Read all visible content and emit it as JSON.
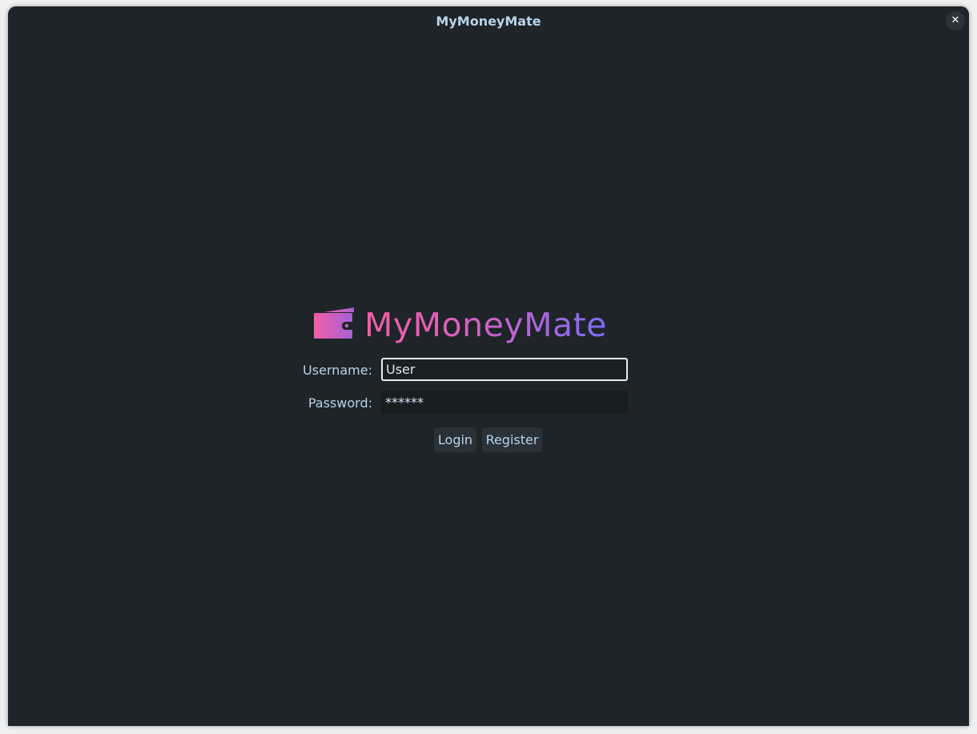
{
  "window": {
    "title": "MyMoneyMate",
    "close_icon": "close-icon",
    "close_glyph": "✕"
  },
  "logo": {
    "text": "MyMoneyMate",
    "icon": "wallet-icon",
    "gradient_start": "#f15fa3",
    "gradient_end": "#7b6ef6"
  },
  "form": {
    "username_label": "Username:",
    "username_value": "User",
    "password_label": "Password:",
    "password_value": "******"
  },
  "buttons": {
    "login_label": "Login",
    "register_label": "Register"
  },
  "colors": {
    "background": "#1e2428",
    "text": "#b9d4ea",
    "button": "#2a3137"
  }
}
